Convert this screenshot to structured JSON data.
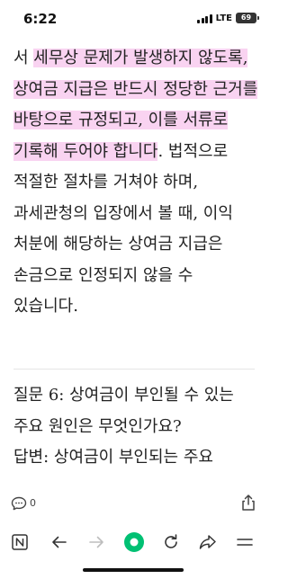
{
  "status_bar": {
    "time": "6:22",
    "network": "LTE",
    "battery": "69"
  },
  "article": {
    "paragraph": [
      {
        "text": "서 ",
        "highlight": false
      },
      {
        "text": "세무상 문제가 발생하지 않도록, 상여금 지급은 반드시 정당한 근거를 바탕으로 규정되고, 이를 서류로 기록해 두어야 합니다",
        "highlight": true
      },
      {
        "text": ". 법적으로 적절한 절차를 거쳐야 하며, 과세관청의 입장에서 볼 때, 이익 처분에 해당하는 상여금 지급은 손금으로 인정되지 않을 수 있습니다.",
        "highlight": false
      }
    ],
    "question": "질문 6: 상여금이 부인될 수 있는 주요 원인은 무엇인가요?",
    "answer_partial": "답변: 상여금이 부인되는 주요"
  },
  "comments": {
    "count": "0"
  },
  "colors": {
    "highlight": "#f9d3f1",
    "accent": "#00c073"
  },
  "bottom_nav": [
    "naver-n-icon",
    "back-icon",
    "forward-icon",
    "green-dot-icon",
    "refresh-icon",
    "share-arrow-icon",
    "menu-icon"
  ]
}
